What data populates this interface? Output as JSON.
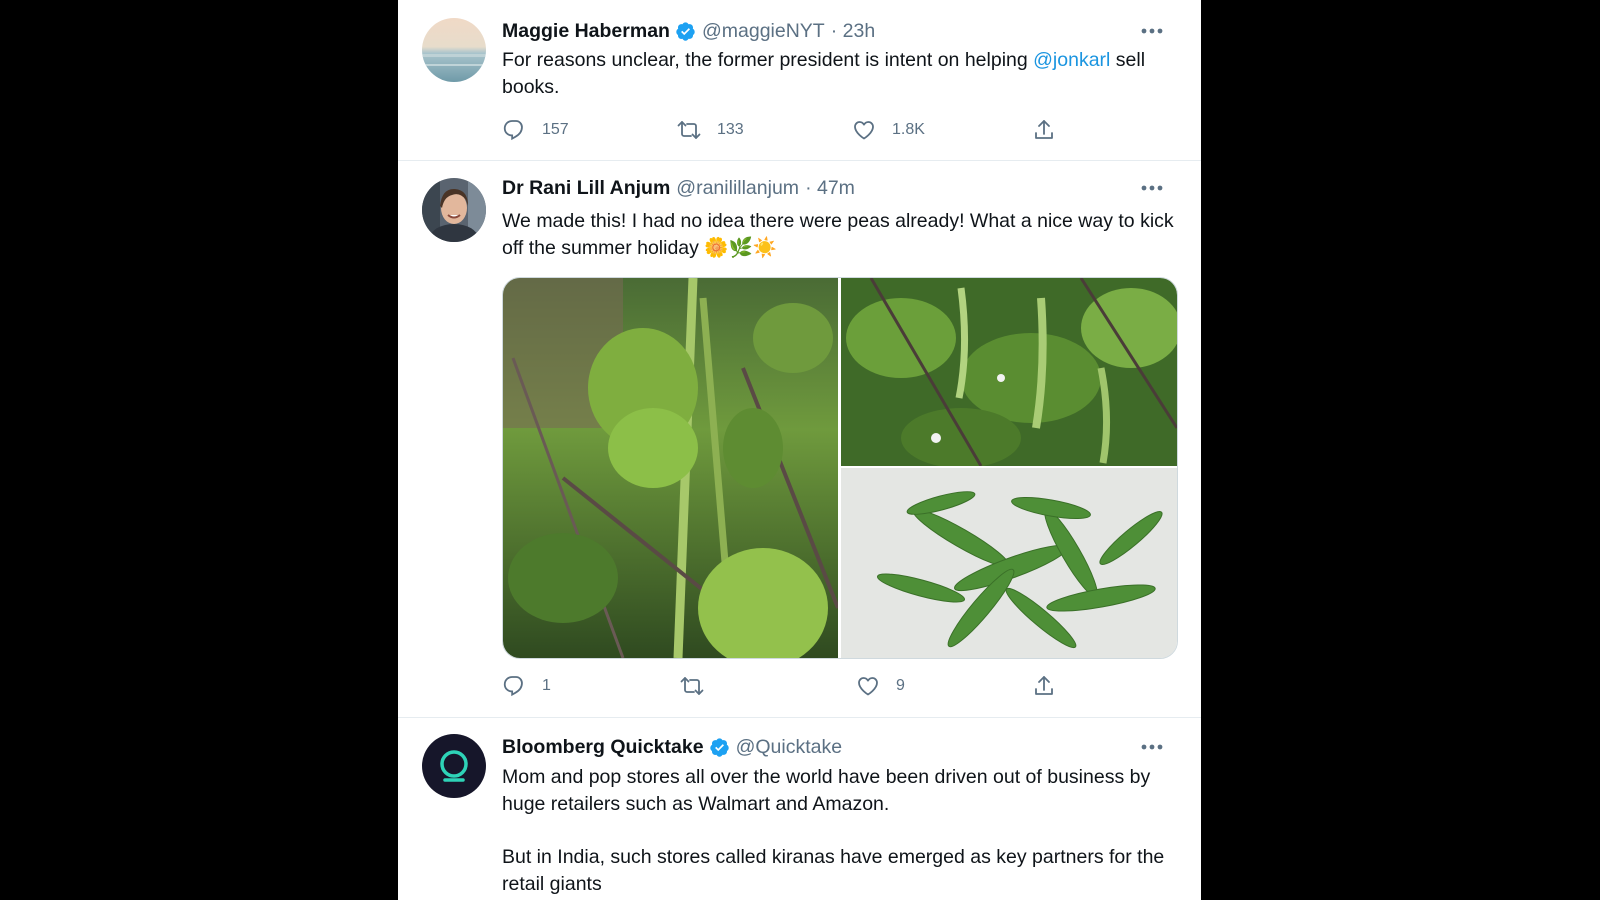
{
  "tweets": [
    {
      "name": "Maggie Haberman",
      "handle": "@maggieNYT",
      "time": "· 23h",
      "text_before": "For reasons unclear, the former president is intent on helping ",
      "mention": "@jonkarl",
      "text_after": " sell books.",
      "replies": "157",
      "retweets": "133",
      "likes": "1.8K"
    },
    {
      "name": "Dr Rani Lill Anjum",
      "handle": "@ranilillanjum",
      "time": "· 47m",
      "text": "We made this! I had no idea there were peas already! What a nice way to kick off the summer holiday 🌼🌿☀️",
      "replies": "1",
      "likes": "9"
    },
    {
      "name": "Bloomberg Quicktake",
      "handle": "@Quicktake",
      "paragraph1": "Mom and pop stores all over the world have been driven out of business by huge retailers such as Walmart and Amazon.",
      "paragraph2": "But in India, such stores called kiranas have emerged as key partners for the retail giants"
    }
  ],
  "colors": {
    "verified": "#1da1f2",
    "link": "#1b95e0",
    "secondary_text": "#5b7083",
    "quicktake_brand": "#2ed3b7"
  }
}
